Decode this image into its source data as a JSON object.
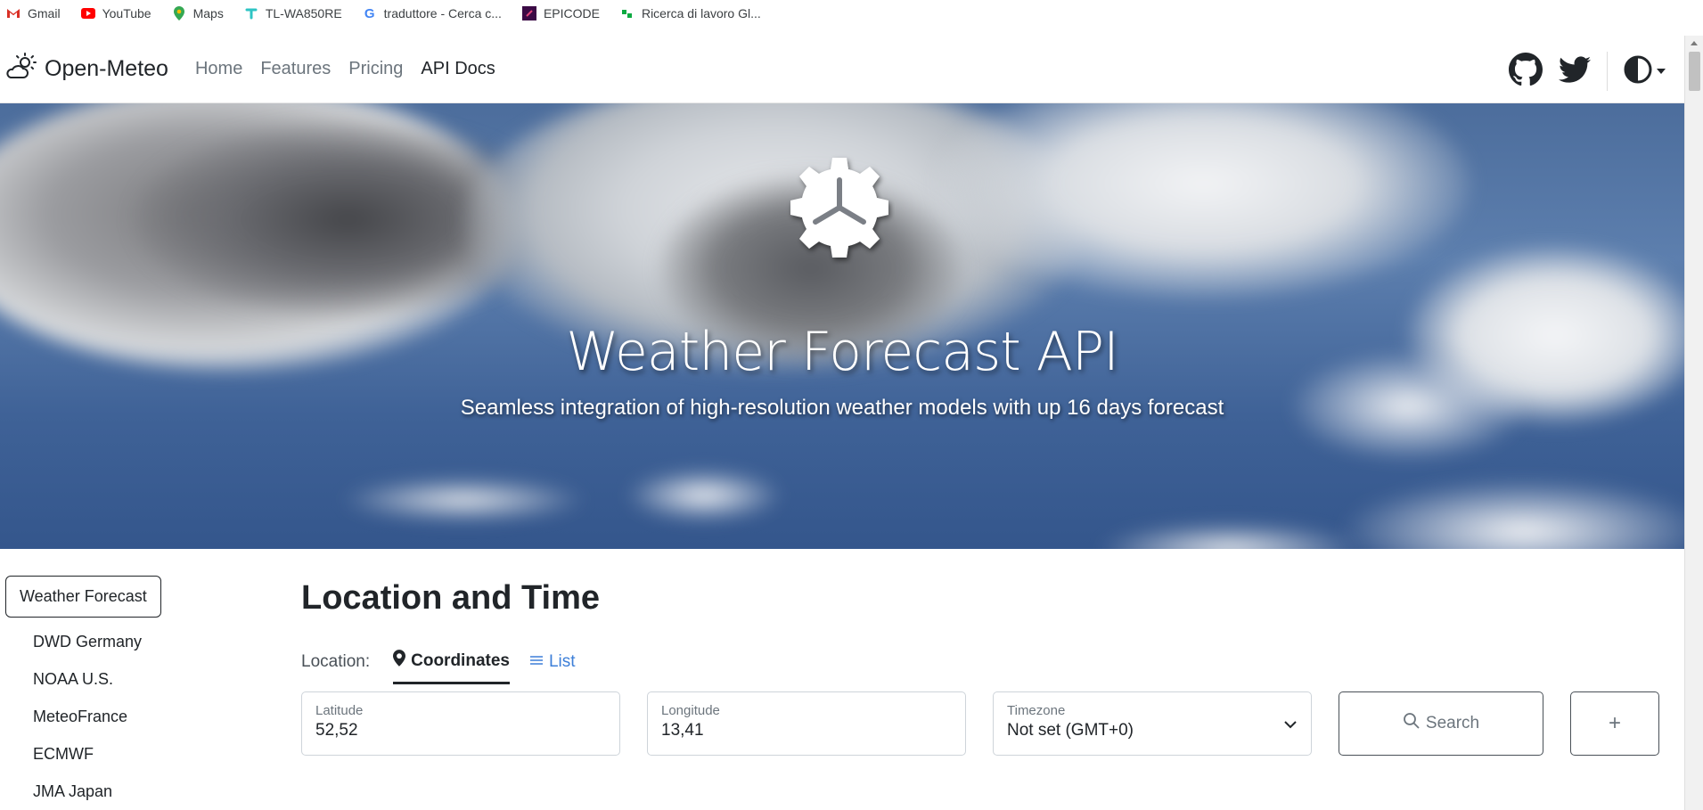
{
  "bookmarks": [
    {
      "label": "Gmail",
      "icon": "gmail-icon",
      "color": "#d93025"
    },
    {
      "label": "YouTube",
      "icon": "youtube-icon",
      "color": "#ff0000"
    },
    {
      "label": "Maps",
      "icon": "maps-icon",
      "color": "#34a853"
    },
    {
      "label": "TL-WA850RE",
      "icon": "tplink-icon",
      "color": "#2ec4c4"
    },
    {
      "label": "traduttore - Cerca c...",
      "icon": "google-icon",
      "color": "#4285f4"
    },
    {
      "label": "EPICODE",
      "icon": "epicode-icon",
      "color": "#3b0a45"
    },
    {
      "label": "Ricerca di lavoro Gl...",
      "icon": "glassdoor-icon",
      "color": "#0caa41"
    }
  ],
  "navbar": {
    "brand": "Open-Meteo",
    "links": [
      "Home",
      "Features",
      "Pricing",
      "API Docs"
    ],
    "active_link": "API Docs"
  },
  "hero": {
    "title": "Weather Forecast API",
    "subtitle": "Seamless integration of high-resolution weather models with up 16 days forecast"
  },
  "sidebar": {
    "active": "Weather Forecast",
    "items": [
      "DWD Germany",
      "NOAA U.S.",
      "MeteoFrance",
      "ECMWF",
      "JMA Japan"
    ]
  },
  "main": {
    "title": "Location and Time",
    "location_label": "Location:",
    "tabs": [
      "Coordinates",
      "List"
    ],
    "latitude": {
      "label": "Latitude",
      "value": "52,52"
    },
    "longitude": {
      "label": "Longitude",
      "value": "13,41"
    },
    "timezone": {
      "label": "Timezone",
      "value": "Not set (GMT+0)"
    },
    "search_label": "Search",
    "add_label": "+"
  },
  "colors": {
    "accent_link": "#3d7fd8",
    "text": "#212529",
    "muted": "#6c757d"
  }
}
